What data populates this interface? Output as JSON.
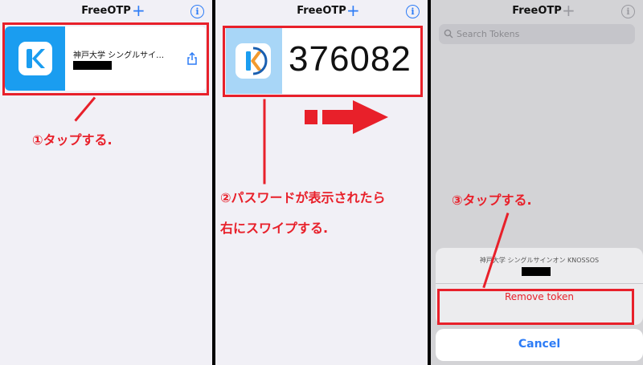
{
  "app": {
    "title": "FreeOTP"
  },
  "panel1": {
    "issuer": "神戸大学 シングルサイ…",
    "note": "①タップする."
  },
  "panel2": {
    "code": "376082",
    "note_line1": "②パスワードが表示されたら",
    "note_line2": "右にスワイプする."
  },
  "panel3": {
    "search_placeholder": "Search Tokens",
    "sheet_title": "神戸大学 シングルサインオン KNOSSOS",
    "remove_label": "Remove token",
    "cancel_label": "Cancel",
    "note": "③タップする."
  },
  "icons": {
    "add": "+",
    "info": "i",
    "share": "share-icon",
    "search": "search-icon"
  },
  "colors": {
    "accent": "#2d7cf6",
    "annotation_red": "#e8202a",
    "token_blue": "#1a9df0"
  }
}
